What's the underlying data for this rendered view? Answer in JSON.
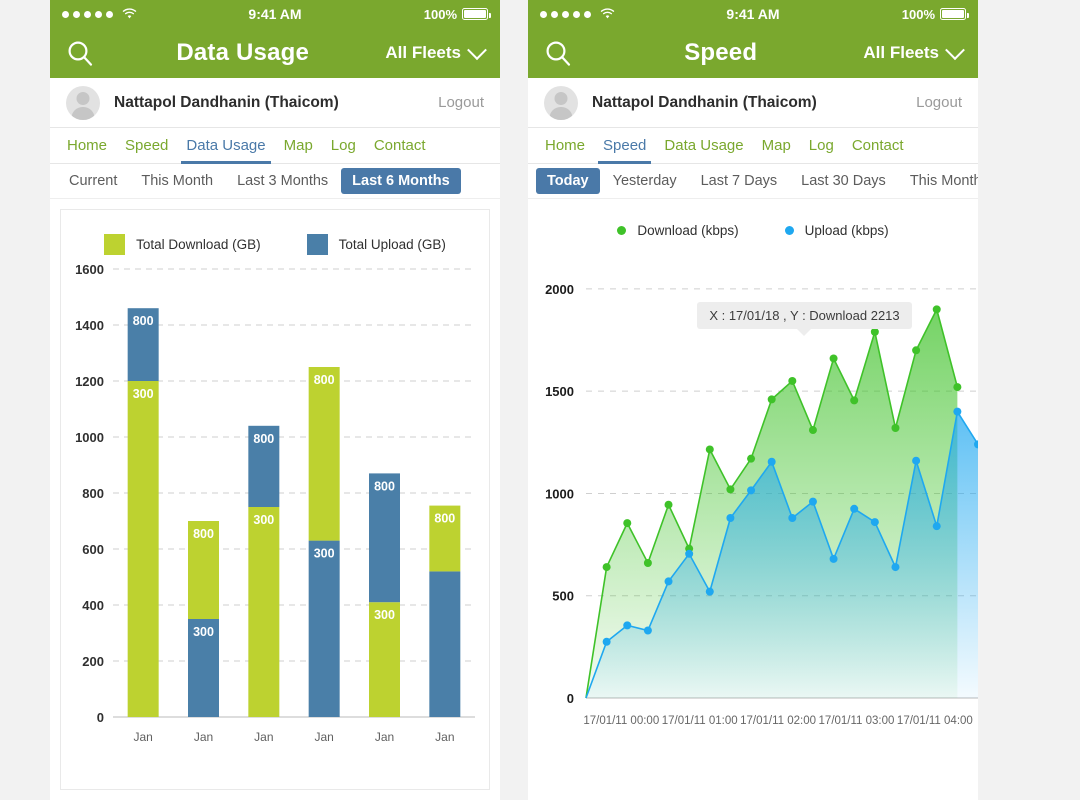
{
  "theme": {
    "green": "#7aa82e",
    "blue": "#4a79a8",
    "bar_green": "#bdd230",
    "bar_blue": "#4a7fa8",
    "line_green": "#3fc229",
    "line_blue": "#1fa8f0",
    "muted": "#9a9a9a"
  },
  "panels": [
    {
      "status": {
        "time": "9:41 AM",
        "battery": "100%",
        "signal_dots": 5,
        "wifi_icon": "wifi-icon"
      },
      "nav": {
        "search_icon": "search-icon",
        "title": "Data Usage",
        "fleets": "All Fleets",
        "chevron": "chevron-down-icon"
      },
      "user": {
        "name": "Nattapol Dandhanin (Thaicom)",
        "logout": "Logout",
        "avatar_icon": "avatar-icon"
      },
      "tabs": [
        {
          "label": "Home",
          "active": false
        },
        {
          "label": "Speed",
          "active": false
        },
        {
          "label": "Data Usage",
          "active": true
        },
        {
          "label": "Map",
          "active": false
        },
        {
          "label": "Log",
          "active": false
        },
        {
          "label": "Contact",
          "active": false
        }
      ],
      "filters": [
        {
          "label": "Current",
          "active": false
        },
        {
          "label": "This Month",
          "active": false
        },
        {
          "label": "Last 3 Months",
          "active": false
        },
        {
          "label": "Last 6 Months",
          "active": true
        }
      ]
    },
    {
      "status": {
        "time": "9:41 AM",
        "battery": "100%",
        "signal_dots": 5,
        "wifi_icon": "wifi-icon"
      },
      "nav": {
        "search_icon": "search-icon",
        "title": "Speed",
        "fleets": "All Fleets",
        "chevron": "chevron-down-icon"
      },
      "user": {
        "name": "Nattapol Dandhanin (Thaicom)",
        "logout": "Logout",
        "avatar_icon": "avatar-icon"
      },
      "tabs": [
        {
          "label": "Home",
          "active": false
        },
        {
          "label": "Speed",
          "active": true
        },
        {
          "label": "Data Usage",
          "active": false
        },
        {
          "label": "Map",
          "active": false
        },
        {
          "label": "Log",
          "active": false
        },
        {
          "label": "Contact",
          "active": false
        }
      ],
      "filters": [
        {
          "label": "Today",
          "active": true
        },
        {
          "label": "Yesterday",
          "active": false
        },
        {
          "label": "Last 7 Days",
          "active": false
        },
        {
          "label": "Last 30 Days",
          "active": false
        },
        {
          "label": "This Month",
          "active": false
        }
      ]
    }
  ],
  "chart_data": [
    {
      "type": "bar",
      "stacked": true,
      "title": "",
      "xlabel": "",
      "ylabel": "",
      "ylim": [
        0,
        1600
      ],
      "yticks": [
        0,
        200,
        400,
        600,
        800,
        1000,
        1200,
        1400,
        1600
      ],
      "grid": true,
      "legend_position": "top-center",
      "categories": [
        "Jan",
        "Jan",
        "Jan",
        "Jan",
        "Jan",
        "Jan"
      ],
      "series": [
        {
          "name": "Total Download (GB)",
          "color": "#bdd230",
          "values": [
            1200,
            350,
            750,
            620,
            410,
            235
          ]
        },
        {
          "name": "Total Upload (GB)",
          "color": "#4a7fa8",
          "values": [
            260,
            350,
            290,
            630,
            460,
            520
          ]
        }
      ],
      "bars": [
        {
          "category": "Jan",
          "total": 1460,
          "segments": [
            {
              "series": "Total Download (GB)",
              "from": 0,
              "to": 1200,
              "label": "300",
              "color": "#bdd230"
            },
            {
              "series": "Total Upload (GB)",
              "from": 1200,
              "to": 1460,
              "label": "800",
              "color": "#4a7fa8"
            }
          ]
        },
        {
          "category": "Jan",
          "total": 700,
          "segments": [
            {
              "series": "Total Upload (GB)",
              "from": 0,
              "to": 350,
              "label": "300",
              "color": "#4a7fa8"
            },
            {
              "series": "Total Download (GB)",
              "from": 350,
              "to": 700,
              "label": "800",
              "color": "#bdd230"
            }
          ]
        },
        {
          "category": "Jan",
          "total": 1040,
          "segments": [
            {
              "series": "Total Download (GB)",
              "from": 0,
              "to": 750,
              "label": "300",
              "color": "#bdd230"
            },
            {
              "series": "Total Upload (GB)",
              "from": 750,
              "to": 1040,
              "label": "800",
              "color": "#4a7fa8"
            }
          ]
        },
        {
          "category": "Jan",
          "total": 1250,
          "segments": [
            {
              "series": "Total Upload (GB)",
              "from": 0,
              "to": 630,
              "label": "300",
              "color": "#4a7fa8"
            },
            {
              "series": "Total Download (GB)",
              "from": 630,
              "to": 1250,
              "label": "800",
              "color": "#bdd230"
            }
          ]
        },
        {
          "category": "Jan",
          "total": 870,
          "segments": [
            {
              "series": "Total Download (GB)",
              "from": 0,
              "to": 410,
              "label": "300",
              "color": "#bdd230"
            },
            {
              "series": "Total Upload (GB)",
              "from": 410,
              "to": 870,
              "label": "800",
              "color": "#4a7fa8"
            }
          ]
        },
        {
          "category": "Jan",
          "total": 755,
          "segments": [
            {
              "series": "Total Upload (GB)",
              "from": 0,
              "to": 520,
              "label": "",
              "color": "#4a7fa8"
            },
            {
              "series": "Total Download (GB)",
              "from": 520,
              "to": 755,
              "label": "800",
              "color": "#bdd230"
            }
          ]
        }
      ]
    },
    {
      "type": "area",
      "title": "",
      "xlabel": "",
      "ylabel": "",
      "ylim": [
        0,
        2200
      ],
      "yticks": [
        0,
        500,
        1000,
        1500,
        2000
      ],
      "grid": true,
      "legend_position": "top-center",
      "xticks": [
        "17/01/11 00:00",
        "17/01/11 01:00",
        "17/01/11 02:00",
        "17/01/11 03:00",
        "17/01/11 04:00"
      ],
      "annotation": {
        "text": "X : 17/01/18 , Y : Download 2213",
        "point_index": 10,
        "series": "Download (kbps)"
      },
      "series": [
        {
          "name": "Download (kbps)",
          "color": "#3fc229",
          "values": [
            0,
            640,
            855,
            660,
            945,
            730,
            1215,
            1020,
            1170,
            1460,
            1550,
            1310,
            1660,
            1455,
            1790,
            1320,
            1700,
            1900,
            1520
          ]
        },
        {
          "name": "Upload (kbps)",
          "color": "#1fa8f0",
          "values": [
            0,
            275,
            355,
            330,
            570,
            705,
            520,
            880,
            1015,
            1155,
            880,
            960,
            680,
            925,
            860,
            640,
            1160,
            840,
            1400,
            1240
          ]
        }
      ]
    }
  ]
}
